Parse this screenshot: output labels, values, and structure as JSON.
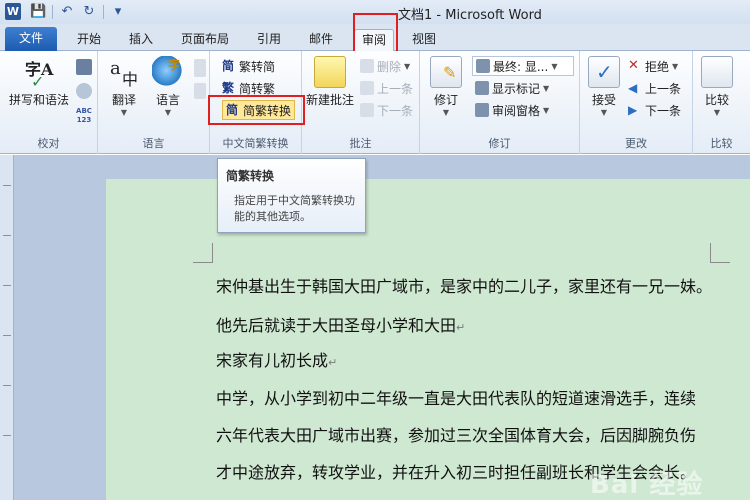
{
  "window": {
    "title": "文档1 - Microsoft Word",
    "app_icon_letter": "W"
  },
  "quick_access": {
    "save": "💾",
    "undo": "↶",
    "redo": "↻",
    "more": "▾"
  },
  "tabs": [
    {
      "label": "文件"
    },
    {
      "label": "开始"
    },
    {
      "label": "插入"
    },
    {
      "label": "页面布局"
    },
    {
      "label": "引用"
    },
    {
      "label": "邮件"
    },
    {
      "label": "审阅"
    },
    {
      "label": "视图"
    }
  ],
  "active_tab": "审阅",
  "ribbon": {
    "proofing": {
      "label": "校对",
      "spelling": "拼写和语法",
      "abc_text": "ABC\n123"
    },
    "language": {
      "label": "语言",
      "translate": "翻译",
      "language": "语言"
    },
    "chinese_conversion": {
      "label": "中文简繁转换",
      "to_simplified": "繁转简",
      "to_traditional": "简转繁",
      "convert": "简繁转换"
    },
    "comments": {
      "label": "批注",
      "new_comment": "新建批注",
      "delete": "删除",
      "previous": "上一条",
      "next": "下一条"
    },
    "tracking": {
      "label": "修订",
      "track_changes": "修订",
      "display": "最终: 显...",
      "show_markup": "显示标记",
      "reviewing_pane": "审阅窗格"
    },
    "changes": {
      "label": "更改",
      "accept": "接受",
      "reject": "拒绝",
      "previous": "上一条",
      "next": "下一条"
    },
    "compare": {
      "label": "比较",
      "compare": "比较"
    }
  },
  "tooltip": {
    "title": "简繁转换",
    "description": "指定用于中文简繁转换功能的其他选项。"
  },
  "document": {
    "paragraphs": [
      "宋仲基出生于韩国大田广域市，是家中的二儿子，家里还有一兄一妹。",
      "他先后就读于大田圣母小学和大田",
      "宋家有儿初长成",
      "中学，从小学到初中二年级一直是大田代表队的短道速滑选手，连续",
      "六年代表大田广域市出赛，参加过三次全国体育大会，后因脚腕负伤",
      "才中途放弃，转攻学业，并在升入初三时担任副班长和学生会会长。"
    ],
    "paragraph_mark": "↵"
  },
  "watermark": "Bai 经验",
  "colors": {
    "highlight": "#e02020",
    "page_bg": "#cfe8d1",
    "file_tab": "#1d5bb0"
  }
}
